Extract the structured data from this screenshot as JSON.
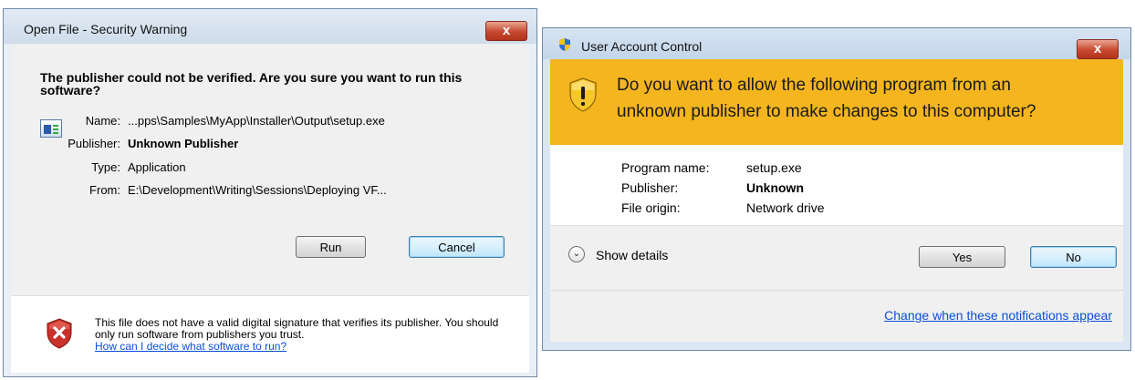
{
  "security_warning": {
    "title": "Open File - Security Warning",
    "close_label": "x",
    "heading": "The publisher could not be verified.  Are you sure you want to run this software?",
    "fields": [
      {
        "label": "Name:",
        "value": "...pps\\Samples\\MyApp\\Installer\\Output\\setup.exe"
      },
      {
        "label": "Publisher:",
        "value": "Unknown Publisher"
      },
      {
        "label": "Type:",
        "value": "Application"
      },
      {
        "label": "From:",
        "value": "E:\\Development\\Writing\\Sessions\\Deploying VF..."
      }
    ],
    "run_label": "Run",
    "cancel_label": "Cancel",
    "footer_text": "This file does not have a valid digital signature that verifies its publisher.  You should only run software from publishers you trust.",
    "footer_link": "How can I decide what software to run?"
  },
  "uac": {
    "title": "User Account Control",
    "close_label": "x",
    "question_line1": "Do you want to allow the following program from an",
    "question_line2": "unknown publisher to make changes to this computer?",
    "fields": [
      {
        "label": "Program name:",
        "value": "setup.exe"
      },
      {
        "label": "Publisher:",
        "value": "Unknown"
      },
      {
        "label": "File origin:",
        "value": "Network drive"
      }
    ],
    "show_details_label": "Show details",
    "yes_label": "Yes",
    "no_label": "No",
    "change_link": "Change when these notifications appear"
  },
  "colors": {
    "uac_banner": "#f4b51f",
    "link": "#0a4fd8",
    "close_button": "#c6482f"
  },
  "icons": [
    "application-icon",
    "error-shield-icon",
    "uac-shield-icon",
    "warning-shield-icon",
    "chevron-down-icon",
    "close-icon"
  ]
}
